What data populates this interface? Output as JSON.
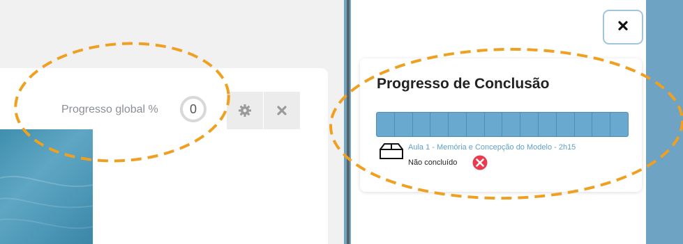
{
  "left": {
    "progress_label": "Progresso global %",
    "progress_value": "0",
    "settings_icon": "gear-icon",
    "close_icon": "close-icon"
  },
  "panel": {
    "close_icon": "close-icon",
    "title": "Progresso de Conclusão",
    "segments_total": 14,
    "segments_completed": 0,
    "lesson_link": "Aula 1 - Memória e Concepção do Modelo - 2h15",
    "lesson_icon": "box-icon",
    "status": "Não concluído",
    "status_icon": "error-icon"
  },
  "colors": {
    "accent": "#6aa9cf",
    "annotation": "#f0a020",
    "error": "#ea3b4e"
  }
}
